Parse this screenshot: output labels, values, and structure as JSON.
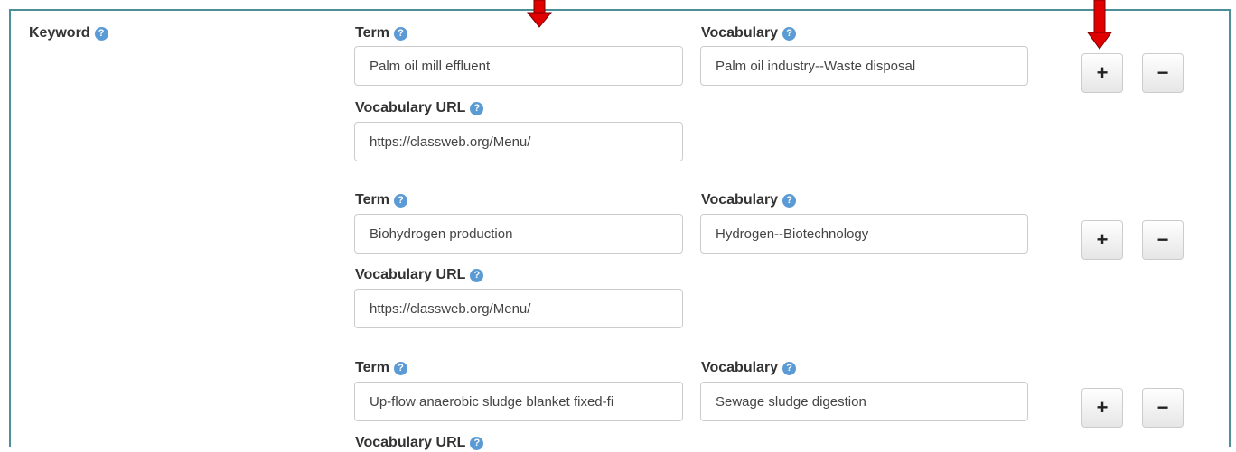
{
  "keyword": {
    "label": "Keyword",
    "help_icon": "question-circle-icon",
    "entries": [
      {
        "term_label": "Term",
        "term_value": "Palm oil mill effluent",
        "vocab_label": "Vocabulary",
        "vocab_value": "Palm oil industry--Waste disposal",
        "url_label": "Vocabulary URL",
        "url_value": "https://classweb.org/Menu/"
      },
      {
        "term_label": "Term",
        "term_value": "Biohydrogen production",
        "vocab_label": "Vocabulary",
        "vocab_value": "Hydrogen--Biotechnology",
        "url_label": "Vocabulary URL",
        "url_value": "https://classweb.org/Menu/"
      },
      {
        "term_label": "Term",
        "term_value": "Up-flow anaerobic sludge blanket fixed-fi",
        "vocab_label": "Vocabulary",
        "vocab_value": "Sewage sludge digestion",
        "url_label": "Vocabulary URL"
      }
    ],
    "add_label": "+",
    "remove_label": "−"
  },
  "colors": {
    "panel_border": "#4d8f99",
    "help_icon": "#5b9bd5",
    "annotation_arrow": "#e00000"
  }
}
